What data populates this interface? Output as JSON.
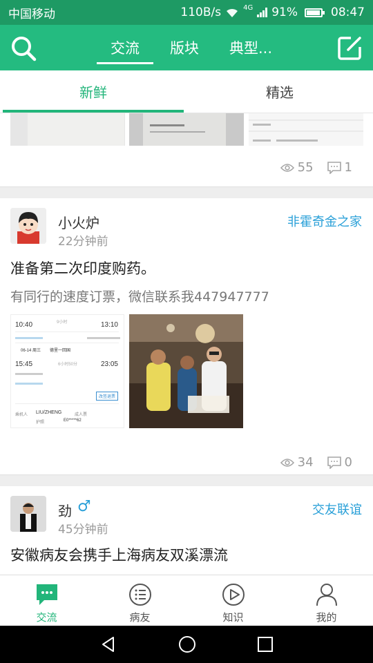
{
  "status": {
    "carrier": "中国移动",
    "speed": "110B/s",
    "signal": "4G",
    "battery": "91%",
    "time": "08:47"
  },
  "header": {
    "tabs": [
      {
        "label": "交流"
      },
      {
        "label": "版块"
      },
      {
        "label": "典型..."
      }
    ]
  },
  "subtabs": [
    {
      "label": "新鲜"
    },
    {
      "label": "精选"
    }
  ],
  "posts": [
    {
      "views": "55",
      "comments": "1"
    },
    {
      "user": "小火炉",
      "time": "22分钟前",
      "board": "非霍奇金之家",
      "title": "准备第二次印度购药。",
      "desc": "有同行的速度订票，微信联系我447947777",
      "ticket": {
        "dep1": "10:40",
        "arr1": "13:10",
        "dur1": "9小时",
        "date": "06-14 周三",
        "route": "德里一回国",
        "dep2": "15:45",
        "arr2": "23:05",
        "dur2": "6小时50分",
        "button": "改签退票",
        "passenger_label": "乘机人",
        "passenger": "LIU/ZHENG",
        "ptype": "成人票",
        "id_label": "护照",
        "id": "E0*****62"
      },
      "views": "34",
      "comments": "0"
    },
    {
      "user": "劲",
      "gender": "♂",
      "time": "45分钟前",
      "board": "交友联谊",
      "title": "安徽病友会携手上海病友双溪漂流"
    }
  ],
  "bottomnav": [
    {
      "label": "交流"
    },
    {
      "label": "病友"
    },
    {
      "label": "知识"
    },
    {
      "label": "我的"
    }
  ],
  "colors": {
    "primary": "#24bb80",
    "statusbar": "#1e9a64",
    "link": "#2aa0d8"
  }
}
